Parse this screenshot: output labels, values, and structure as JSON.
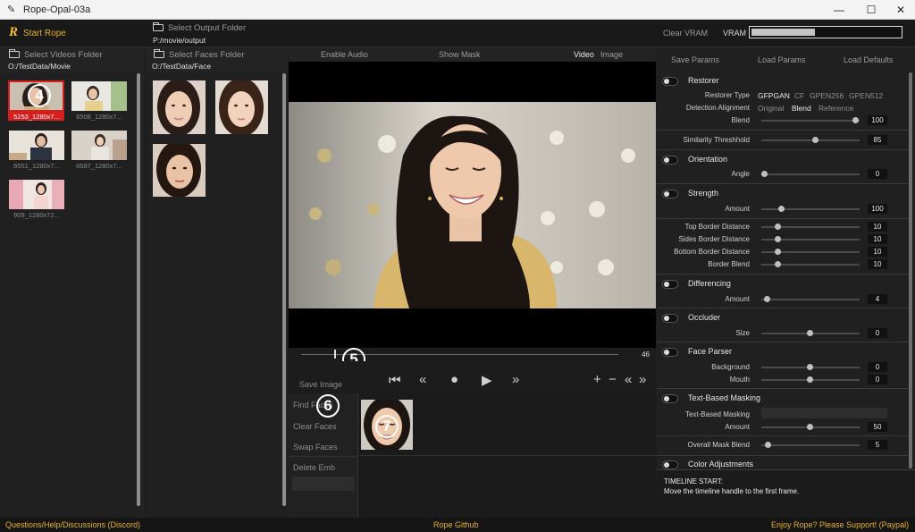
{
  "window": {
    "title": "Rope-Opal-03a",
    "minimize": "—",
    "maximize": "☐",
    "close": "✕"
  },
  "topbar": {
    "start_label": "Start Rope",
    "start_logo": "R",
    "output_folder_label": "Select Output Folder",
    "output_folder_path": "P:/movie/output",
    "clear_vram": "Clear VRAM",
    "vram_label": "VRAM",
    "vram_usage": 0.42
  },
  "videos": {
    "folder_label": "Select Videos Folder",
    "folder_path": "O:/TestData/Movie",
    "items": [
      {
        "label": "5253_1280x7...",
        "selected": true
      },
      {
        "label": "6508_1280x7...",
        "selected": false
      },
      {
        "label": "6551_1280x7...",
        "selected": false
      },
      {
        "label": "6587_1280x7...",
        "selected": false
      },
      {
        "label": "909_1280x72...",
        "selected": false
      }
    ]
  },
  "faces": {
    "folder_label": "Select Faces Folder",
    "folder_path": "O:/TestData/Face"
  },
  "viewer": {
    "enable_audio": "Enable Audio",
    "show_mask": "Show Mask",
    "tab_video": "Video",
    "tab_image": "Image",
    "frame_value": "46",
    "save_image": "Save Image",
    "find_faces": "Find Faces",
    "clear_faces": "Clear Faces",
    "swap_faces": "Swap Faces",
    "delete_emb": "Delete Emb"
  },
  "annotations": {
    "n4": "4",
    "n5": "5",
    "n6": "6",
    "n7": "7"
  },
  "params": {
    "save": "Save Params",
    "load": "Load Params",
    "defaults": "Load Defaults",
    "restorer": {
      "title": "Restorer",
      "type_label": "Restorer Type",
      "types": [
        "GFPGAN",
        "CF",
        "GPEN256",
        "GPEN512"
      ],
      "detect_label": "Detection Alignment",
      "detect_opts": [
        "Original",
        "Blend",
        "Reference"
      ],
      "blend_label": "Blend",
      "blend_value": "100"
    },
    "similarity": {
      "label": "Similarity Threshhold",
      "value": "85"
    },
    "orientation": {
      "title": "Orientation",
      "label": "Angle",
      "value": "0"
    },
    "strength": {
      "title": "Strength",
      "label": "Amount",
      "value": "100"
    },
    "borders": [
      {
        "label": "Top Border Distance",
        "value": "10"
      },
      {
        "label": "Sides Border Distance",
        "value": "10"
      },
      {
        "label": "Bottom Border Distance",
        "value": "10"
      },
      {
        "label": "Border Blend",
        "value": "10"
      }
    ],
    "differencing": {
      "title": "Differencing",
      "label": "Amount",
      "value": "4"
    },
    "occluder": {
      "title": "Occluder",
      "label": "Size",
      "value": "0"
    },
    "face_parser": {
      "title": "Face Parser",
      "bg_label": "Background",
      "bg_value": "0",
      "mouth_label": "Mouth",
      "mouth_value": "0"
    },
    "text_mask": {
      "title": "Text-Based Masking",
      "field_label": "Text-Based Masking",
      "amount_label": "Amount",
      "amount_value": "50"
    },
    "overall": {
      "label": "Overall Mask Blend",
      "value": "5"
    },
    "color": {
      "title": "Color Adjustments"
    }
  },
  "hint": {
    "title": "TIMELINE START:",
    "text": "Move the timeline handle to the first frame."
  },
  "footer": {
    "discord": "Questions/Help/Discussions (Discord)",
    "github": "Rope Github",
    "support": "Enjoy Rope? Please Support! (Paypal)"
  }
}
